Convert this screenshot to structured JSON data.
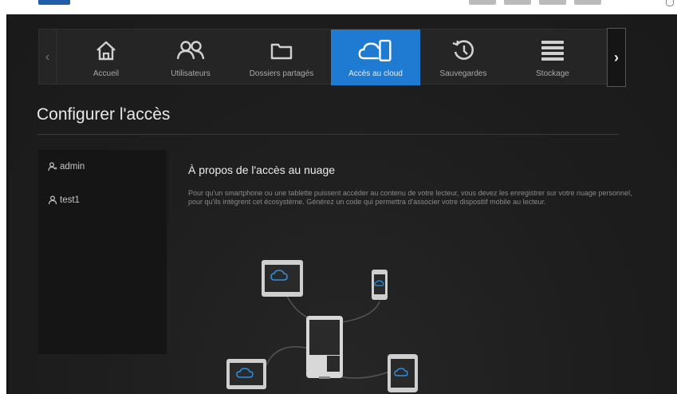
{
  "nav": {
    "items": [
      {
        "label": "Accueil",
        "icon": "home-icon"
      },
      {
        "label": "Utilisateurs",
        "icon": "users-icon"
      },
      {
        "label": "Dossiers partagés",
        "icon": "folder-icon"
      },
      {
        "label": "Accès au cloud",
        "icon": "cloud-phone-icon",
        "active": true
      },
      {
        "label": "Sauvegardes",
        "icon": "history-icon"
      },
      {
        "label": "Stockage",
        "icon": "storage-icon"
      }
    ],
    "prev_glyph": "‹",
    "next_glyph": "›"
  },
  "page": {
    "title": "Configurer l'accès"
  },
  "users": [
    {
      "name": "admin",
      "icon": "admin-user-icon"
    },
    {
      "name": "test1",
      "icon": "user-icon"
    }
  ],
  "content": {
    "title": "À propos de l'accès au nuage",
    "description": "Pour qu'un smartphone ou une tablette puissent accéder au contenu de votre lecteur, vous devez les enregistrer sur votre nuage personnel, pour qu'ils intègrent cet écosystème. Générez un code qui permettra d'associer votre dispositif mobile au lecteur."
  },
  "colors": {
    "accent": "#1f7ad1",
    "background": "#1f1f1f",
    "panel": "#151515",
    "cloud": "#2e8fe0"
  }
}
